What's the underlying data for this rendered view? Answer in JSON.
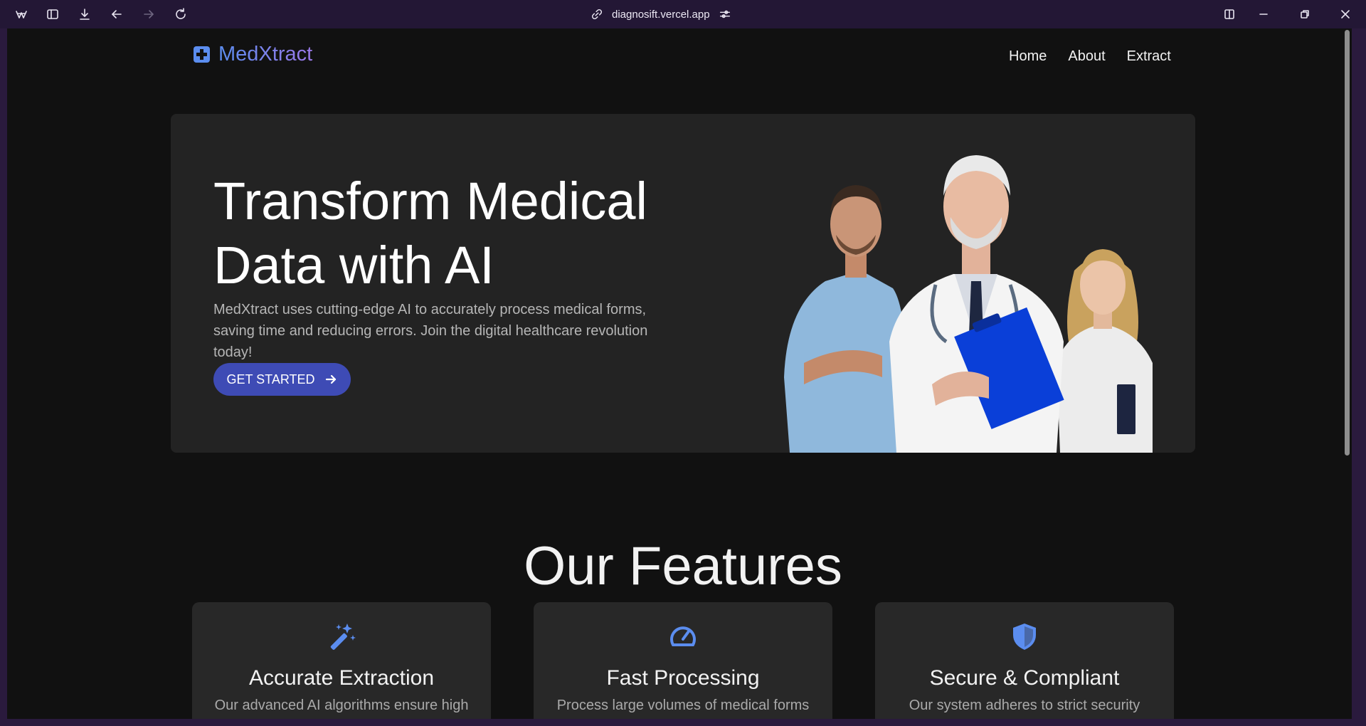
{
  "browser": {
    "url": "diagnosift.vercel.app"
  },
  "nav": {
    "brand": "MedXtract",
    "links": [
      "Home",
      "About",
      "Extract"
    ]
  },
  "hero": {
    "title_line1": "Transform Medical",
    "title_line2": "Data with AI",
    "description": "MedXtract uses cutting-edge AI to accurately process medical forms, saving time and reducing errors. Join the digital healthcare revolution today!",
    "cta_label": "GET STARTED"
  },
  "features": {
    "title": "Our Features",
    "cards": [
      {
        "title": "Accurate Extraction",
        "text": "Our advanced AI algorithms ensure high",
        "icon": "magic-wand-icon"
      },
      {
        "title": "Fast Processing",
        "text": "Process large volumes of medical forms",
        "icon": "speedometer-icon"
      },
      {
        "title": "Secure & Compliant",
        "text": "Our system adheres to strict security",
        "icon": "shield-icon"
      }
    ]
  },
  "colors": {
    "accent": "#5b8def",
    "cta": "#3e4bb5",
    "background": "#111111",
    "card": "#282828"
  }
}
